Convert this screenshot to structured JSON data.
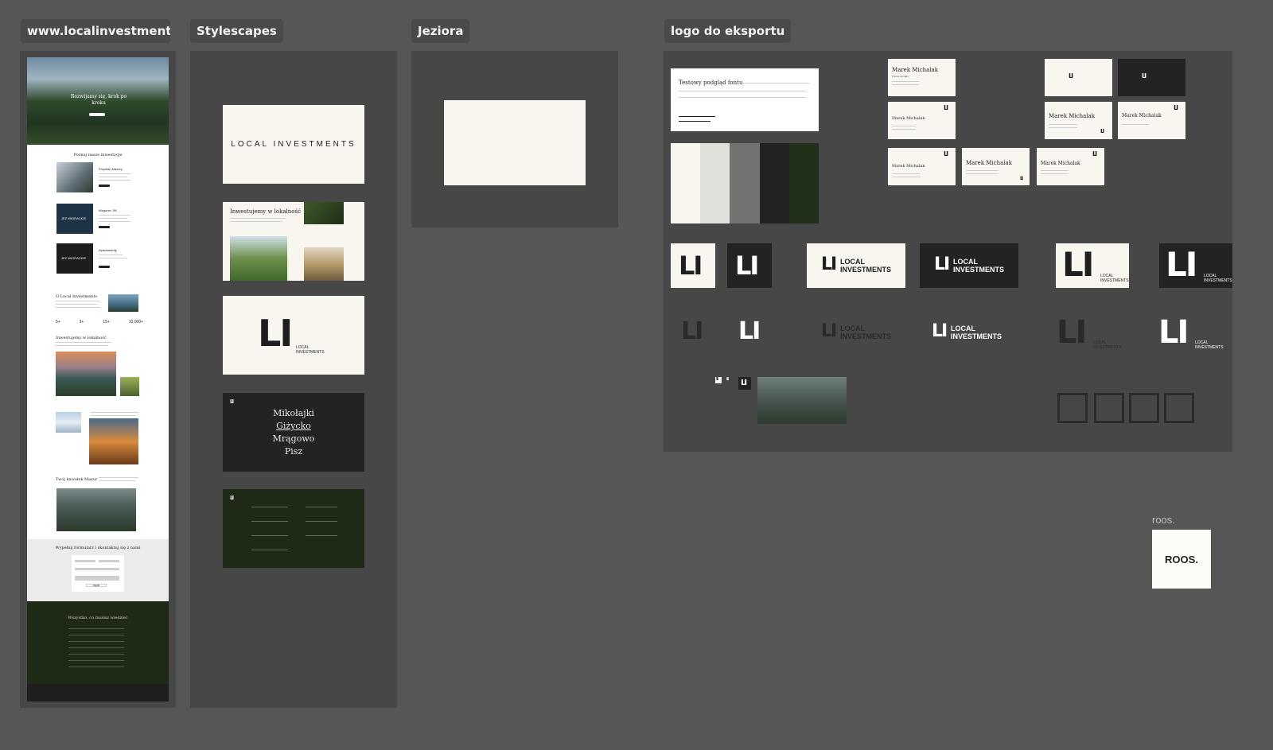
{
  "frames": {
    "website": {
      "label": "www.localinvestments...."
    },
    "stylescapes": {
      "label": "Stylescapes"
    },
    "lakes": {
      "label": "Jeziora"
    },
    "logo_export": {
      "label": "logo do eksportu"
    }
  },
  "website": {
    "hero_title": "Rozwijamy się, krok po kroku",
    "section_invest": "Poznaj nasze inwestycje",
    "invest_items": [
      "Przystań Mazury",
      "Wzgórze JW",
      "Apartamenty"
    ],
    "invest_badge_1": "JEZ WIGRACKIE",
    "invest_badge_2": "JEZ WIGRACKIE",
    "more_label": "więcej",
    "about_title": "O Local Investments",
    "stats": [
      "5+",
      "3+",
      "15+",
      "10,000+"
    ],
    "region_title": "Inwestujemy w lokalność",
    "team_title": "Twój kawałek Mazur",
    "form_title": "Wypełnij formularz i skontaktuj się z nami",
    "form_submit": "Wyślij",
    "faq_title": "Wszystko, co musisz wiedzieć"
  },
  "stylescapes": {
    "brand_wordmark": "LOCAL INVESTMENTS",
    "invest_title": "Inwestujemy w lokalność",
    "logo_letters": "LI",
    "logo_text": "LOCAL\nINVESTMENTS",
    "cities": [
      "Mikołajki",
      "Giżycko",
      "Mrągowo",
      "Pisz"
    ]
  },
  "logo_export": {
    "font_preview_title": "Testowy podgląd fontu",
    "card_name": "Marek Michalak",
    "card_role": "Prezes zarządu",
    "logo_letters": "LI",
    "logo_text_1": "LOCAL",
    "logo_text_2": "INVESTMENTS",
    "roos_label": "roos.",
    "roos_logo": "ROOS."
  }
}
